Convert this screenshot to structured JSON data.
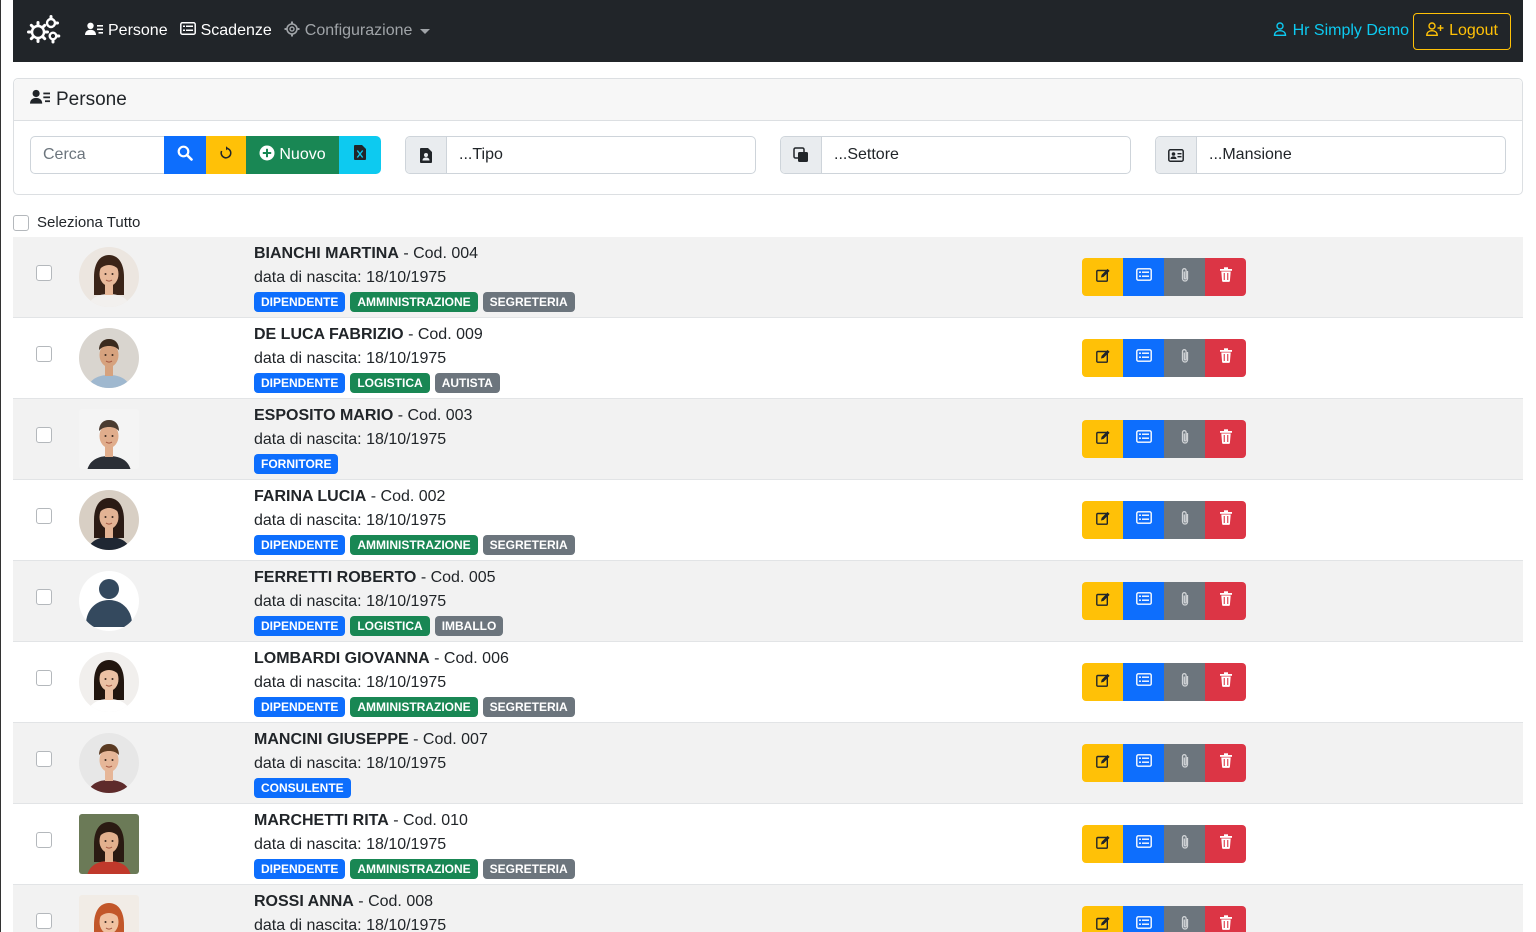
{
  "nav": {
    "brand_icon": "gears-icon",
    "links": [
      {
        "label": "Persone",
        "icon": "person-lines-icon"
      },
      {
        "label": "Scadenze",
        "icon": "card-list-icon"
      },
      {
        "label": "Configurazione",
        "icon": "gear-icon"
      }
    ],
    "user": "Hr Simply Demo",
    "logout": "Logout"
  },
  "panel": {
    "title": "Persone",
    "search_placeholder": "Cerca",
    "new_label": "Nuovo",
    "filters": {
      "tipo": "...Tipo",
      "settore": "...Settore",
      "mansione": "...Mansione"
    }
  },
  "select_all": "Seleziona Tutto",
  "persons": [
    {
      "name": "BIANCHI MARTINA",
      "code": " - Cod. 004",
      "birth": "data di nascita: 18/10/1975",
      "badges": [
        {
          "text": "DIPENDENTE",
          "color": "blue"
        },
        {
          "text": "AMMINISTRAZIONE",
          "color": "green"
        },
        {
          "text": "SEGRETERIA",
          "color": "gray"
        }
      ]
    },
    {
      "name": "DE LUCA FABRIZIO",
      "code": " - Cod. 009",
      "birth": "data di nascita: 18/10/1975",
      "badges": [
        {
          "text": "DIPENDENTE",
          "color": "blue"
        },
        {
          "text": "LOGISTICA",
          "color": "green"
        },
        {
          "text": "AUTISTA",
          "color": "gray"
        }
      ]
    },
    {
      "name": "ESPOSITO MARIO",
      "code": " - Cod. 003",
      "birth": "data di nascita: 18/10/1975",
      "badges": [
        {
          "text": "FORNITORE",
          "color": "blue"
        }
      ]
    },
    {
      "name": "FARINA LUCIA",
      "code": " - Cod. 002",
      "birth": "data di nascita: 18/10/1975",
      "badges": [
        {
          "text": "DIPENDENTE",
          "color": "blue"
        },
        {
          "text": "AMMINISTRAZIONE",
          "color": "green"
        },
        {
          "text": "SEGRETERIA",
          "color": "gray"
        }
      ]
    },
    {
      "name": "FERRETTI ROBERTO",
      "code": " - Cod. 005",
      "birth": "data di nascita: 18/10/1975",
      "badges": [
        {
          "text": "DIPENDENTE",
          "color": "blue"
        },
        {
          "text": "LOGISTICA",
          "color": "green"
        },
        {
          "text": "IMBALLO",
          "color": "gray"
        }
      ]
    },
    {
      "name": "LOMBARDI GIOVANNA",
      "code": " - Cod. 006",
      "birth": "data di nascita: 18/10/1975",
      "badges": [
        {
          "text": "DIPENDENTE",
          "color": "blue"
        },
        {
          "text": "AMMINISTRAZIONE",
          "color": "green"
        },
        {
          "text": "SEGRETERIA",
          "color": "gray"
        }
      ]
    },
    {
      "name": "MANCINI GIUSEPPE",
      "code": " - Cod. 007",
      "birth": "data di nascita: 18/10/1975",
      "badges": [
        {
          "text": "CONSULENTE",
          "color": "blue"
        }
      ]
    },
    {
      "name": "MARCHETTI RITA",
      "code": " - Cod. 010",
      "birth": "data di nascita: 18/10/1975",
      "badges": [
        {
          "text": "DIPENDENTE",
          "color": "blue"
        },
        {
          "text": "AMMINISTRAZIONE",
          "color": "green"
        },
        {
          "text": "SEGRETERIA",
          "color": "gray"
        }
      ]
    },
    {
      "name": "ROSSI ANNA",
      "code": " - Cod. 008",
      "birth": "data di nascita: 18/10/1975",
      "badges": []
    }
  ],
  "avatars": [
    {
      "kind": "woman",
      "bg": "#ece6e0",
      "hair": "#3b2418",
      "skin": "#e8b99a",
      "shirt": "#f2f0ee",
      "shape": "round"
    },
    {
      "kind": "man",
      "bg": "#d9d5cf",
      "hair": "#3a2a1e",
      "skin": "#d6a27e",
      "shirt": "#9fb8cf",
      "shape": "round"
    },
    {
      "kind": "man",
      "bg": "#f4f4f4",
      "hair": "#4a3b30",
      "skin": "#e0ad8c",
      "shirt": "#2b2f36",
      "shape": "square"
    },
    {
      "kind": "woman",
      "bg": "#d8cfc4",
      "hair": "#2b1b14",
      "skin": "#e3b394",
      "shirt": "#1f2733",
      "shape": "round"
    },
    {
      "kind": "placeholder",
      "bg": "#ffffff",
      "hair": "#34495e",
      "skin": "#34495e",
      "shirt": "#34495e",
      "shape": "round"
    },
    {
      "kind": "woman",
      "bg": "#f1efed",
      "hair": "#22160f",
      "skin": "#ebc1a4",
      "shirt": "#ffffff",
      "shape": "round"
    },
    {
      "kind": "man",
      "bg": "#e7e7e7",
      "hair": "#5a3a22",
      "skin": "#e6b698",
      "shirt": "#5e2b2b",
      "shape": "round"
    },
    {
      "kind": "woman",
      "bg": "#6b7a57",
      "hair": "#2a1a12",
      "skin": "#e2b08e",
      "shirt": "#c0392b",
      "shape": "square"
    },
    {
      "kind": "woman",
      "bg": "#f1ece6",
      "hair": "#c2572a",
      "skin": "#f0c2a2",
      "shirt": "#ffffff",
      "shape": "square"
    }
  ],
  "colors": {
    "navbar": "#212529",
    "primary": "#0d6efd",
    "success": "#198754",
    "warning": "#ffc107",
    "danger": "#dc3545",
    "info": "#0dcaf0",
    "secondary": "#6c757d"
  }
}
